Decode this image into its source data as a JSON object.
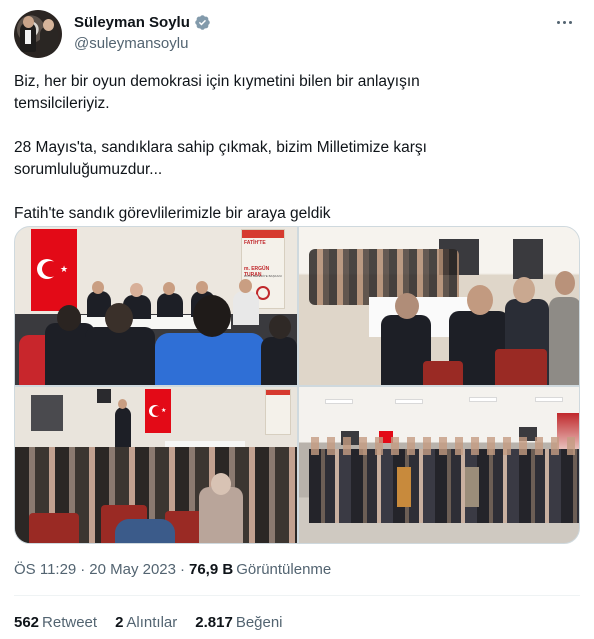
{
  "author": {
    "name": "Süleyman Soylu",
    "handle": "@suleymansoylu"
  },
  "tweet": {
    "lines": [
      "Biz, her bir oyun demokrasi için kıymetini bilen bir anlayışın",
      "temsilcileriyiz.",
      "28 Mayıs'ta, sandıklara sahip çıkmak, bizim Milletimize karşı",
      "sorumluluğumuzdur...",
      "Fatih'te sandık görevlilerimizle bir araya geldik"
    ]
  },
  "photos": {
    "banner_top": "m. ERGÜN TURAN",
    "banner_sub": "FATİH BELEDİYE BAŞKANI",
    "banner_slogan": "FATİH'TE"
  },
  "meta": {
    "time": "ÖS 11:29",
    "date": "20 May 2023",
    "views_count": "76,9 B",
    "views_label": "Görüntülenme"
  },
  "stats": {
    "retweets_count": "562",
    "retweets_label": "Retweet",
    "quotes_count": "2",
    "quotes_label": "Alıntılar",
    "likes_count": "2.817",
    "likes_label": "Beğeni"
  },
  "colors": {
    "text_primary": "#0f1419",
    "text_secondary": "#536471",
    "verified": "#829aab",
    "flag_red": "#e30a17"
  },
  "icons": {
    "verified": "verified-badge-icon",
    "more": "more-options-icon"
  }
}
